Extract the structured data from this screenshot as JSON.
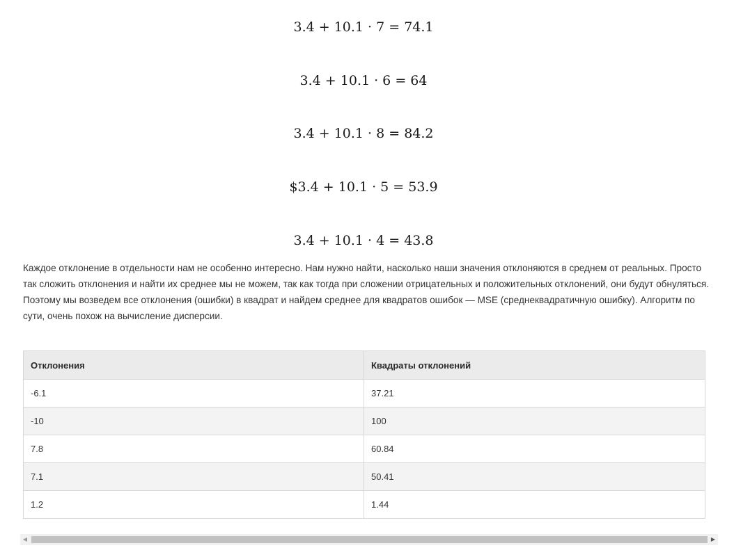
{
  "formulas": [
    "3.4 + 10.1 · 7 = 74.1",
    "3.4 + 10.1 · 6 = 64",
    "3.4 + 10.1 · 8 = 84.2",
    "$3.4 + 10.1 · 5 = 53.9",
    "3.4 + 10.1 · 4 = 43.8"
  ],
  "paragraph": {
    "text": "Каждое отклонение в отдельности нам не особенно интересно. Нам нужно найти, насколько наши значения отклоняются в среднем от реальных. Просто так сложить отклонения и найти их среднее мы не можем, так как тогда при сложении отрицательных и положительных отклонений, они будут обнуляться. Поэтому мы возведем все отклонения (ошибки) в квадрат и найдем среднее для квадратов ошибок — MSE (среднеквадратичную ошибку). Алгоритм по сути, очень похож на вычисление дисперсии."
  },
  "table": {
    "headers": [
      "Отклонения",
      "Квадраты отклонений"
    ],
    "rows": [
      [
        "-6.1",
        "37.21"
      ],
      [
        "-10",
        "100"
      ],
      [
        "7.8",
        "60.84"
      ],
      [
        "7.1",
        "50.41"
      ],
      [
        "1.2",
        "1.44"
      ]
    ]
  },
  "scrollbar": {
    "left_arrow": "◀",
    "right_arrow": "▶"
  }
}
